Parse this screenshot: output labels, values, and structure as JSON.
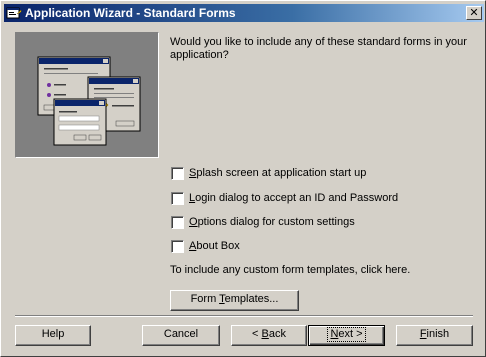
{
  "window": {
    "title": "Application Wizard - Standard Forms",
    "close_glyph": "✕"
  },
  "prompt": "Would you like to include any of these standard forms in your application?",
  "options": [
    {
      "pre": "",
      "ul": "S",
      "post": "plash screen at application start up",
      "checked": false
    },
    {
      "pre": "",
      "ul": "L",
      "post": "ogin dialog to accept an ID and Password",
      "checked": false
    },
    {
      "pre": "",
      "ul": "O",
      "post": "ptions dialog for custom settings",
      "checked": false
    },
    {
      "pre": "",
      "ul": "A",
      "post": "bout Box",
      "checked": false
    }
  ],
  "hint": "To include any custom form templates, click here.",
  "templates_button": {
    "pre": "Form ",
    "ul": "T",
    "post": "emplates..."
  },
  "buttons": {
    "help": "Help",
    "cancel": "Cancel",
    "back": {
      "pre": "< ",
      "ul": "B",
      "post": "ack"
    },
    "next": {
      "pre": "",
      "ul": "N",
      "post": "ext >"
    },
    "finish": {
      "pre": "",
      "ul": "F",
      "post": "inish"
    }
  },
  "colors": {
    "face": "#d4d0c8",
    "title_start": "#0a246a",
    "title_end": "#a6caf0"
  },
  "icons": {
    "title": "wizard-app-icon",
    "illustration": "standard-forms-illustration"
  }
}
